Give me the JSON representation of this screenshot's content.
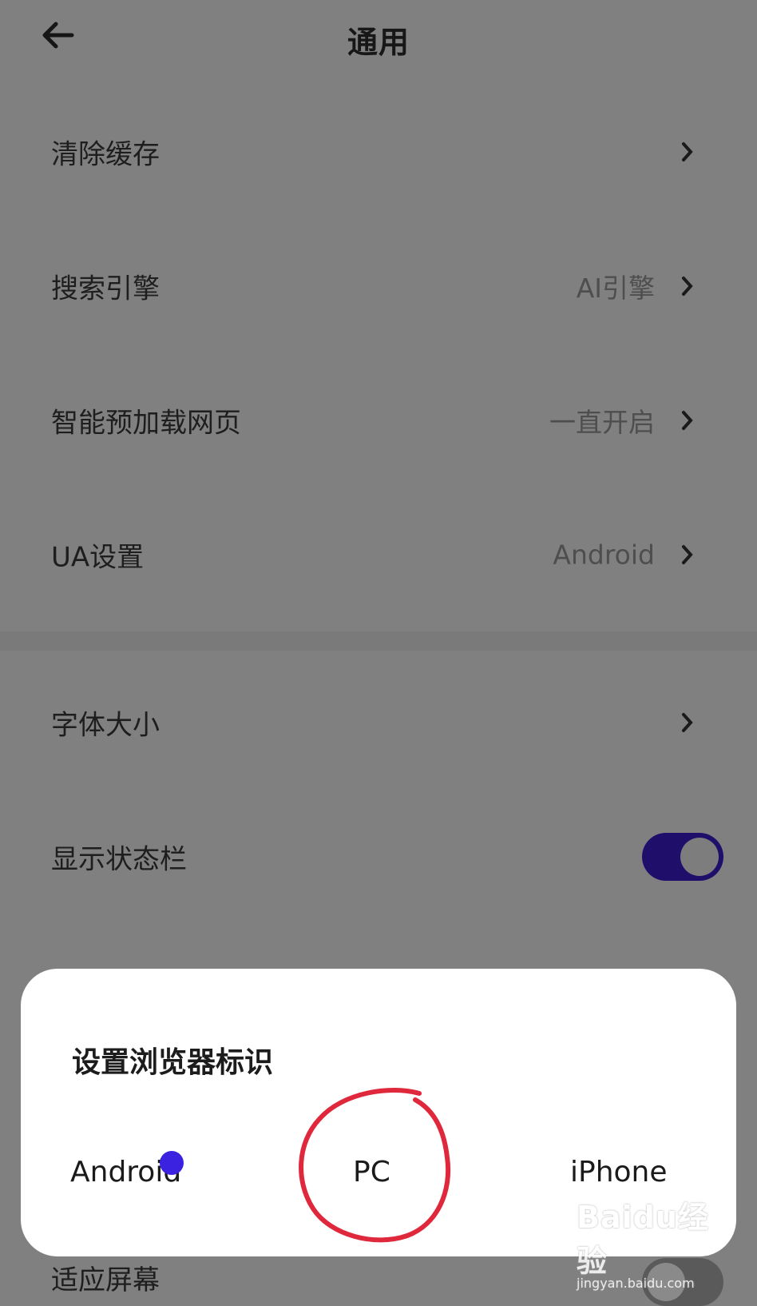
{
  "header": {
    "title": "通用",
    "back_icon": "arrow-left-icon"
  },
  "settings": [
    {
      "label": "清除缓存",
      "value": ""
    },
    {
      "label": "搜索引擎",
      "value": "AI引擎"
    },
    {
      "label": "智能预加载网页",
      "value": "一直开启"
    },
    {
      "label": "UA设置",
      "value": "Android"
    },
    {
      "label": "字体大小",
      "value": ""
    },
    {
      "label": "显示状态栏",
      "toggle": "on"
    }
  ],
  "partially_visible_row": {
    "label": "适应屏幕",
    "toggle": "off"
  },
  "dialog": {
    "title": "设置浏览器标识",
    "options": [
      "Android",
      "PC",
      "iPhone"
    ],
    "selected": "Android"
  },
  "annotation": {
    "type": "red-circle",
    "target": "PC",
    "color": "#e0283c"
  },
  "watermark": {
    "main": "Baidu经验",
    "sub": "jingyan.baidu.com"
  },
  "colors": {
    "accent": "#3a22e0",
    "toggle_on": "#1f0f6b",
    "overlay": "#808080"
  }
}
